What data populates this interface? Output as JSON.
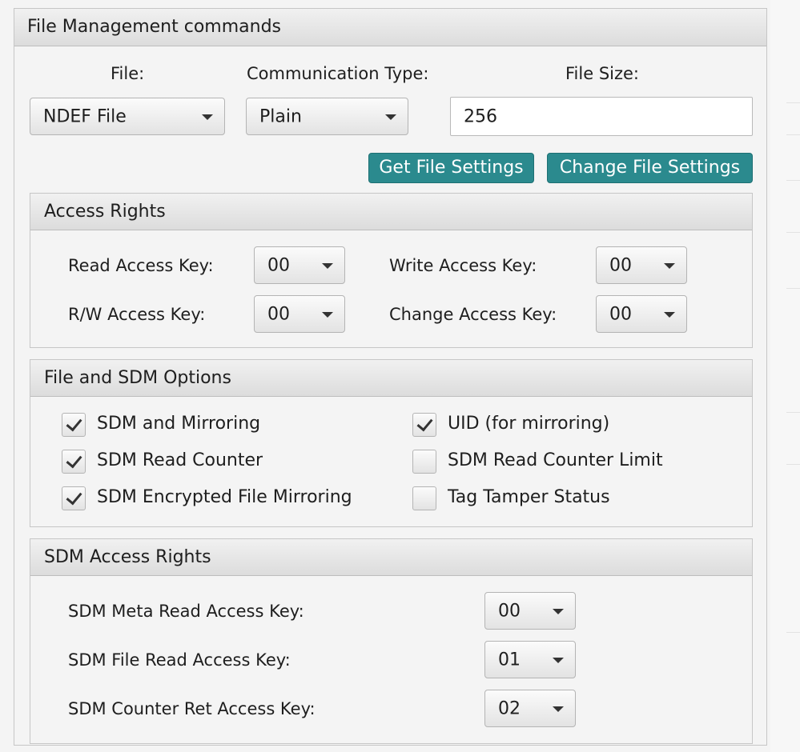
{
  "panel": {
    "title": "File Management commands"
  },
  "file_fields": {
    "file_label": "File:",
    "file_value": "NDEF File",
    "comm_label": "Communication Type:",
    "comm_value": "Plain",
    "size_label": "File Size:",
    "size_value": "256"
  },
  "buttons": {
    "get_settings": "Get File Settings",
    "change_settings": "Change File Settings"
  },
  "access_rights": {
    "title": "Access Rights",
    "read_label": "Read Access Key:",
    "read_value": "00",
    "write_label": "Write Access Key:",
    "write_value": "00",
    "rw_label": "R/W Access Key:",
    "rw_value": "00",
    "change_label": "Change Access Key:",
    "change_value": "00"
  },
  "sdm_options": {
    "title": "File and SDM Options",
    "items": [
      {
        "label": "SDM and Mirroring",
        "checked": true
      },
      {
        "label": "SDM Read Counter",
        "checked": true
      },
      {
        "label": "SDM Encrypted File Mirroring",
        "checked": true
      },
      {
        "label": "UID (for mirroring)",
        "checked": true
      },
      {
        "label": "SDM Read Counter Limit",
        "checked": false
      },
      {
        "label": "Tag Tamper Status",
        "checked": false
      }
    ]
  },
  "sdm_access": {
    "title": "SDM Access Rights",
    "meta_label": "SDM Meta Read Access  Key:",
    "meta_value": "00",
    "file_label": "SDM File Read Access Key:",
    "file_value": "01",
    "counter_label": "SDM Counter Ret Access Key:",
    "counter_value": "02"
  }
}
